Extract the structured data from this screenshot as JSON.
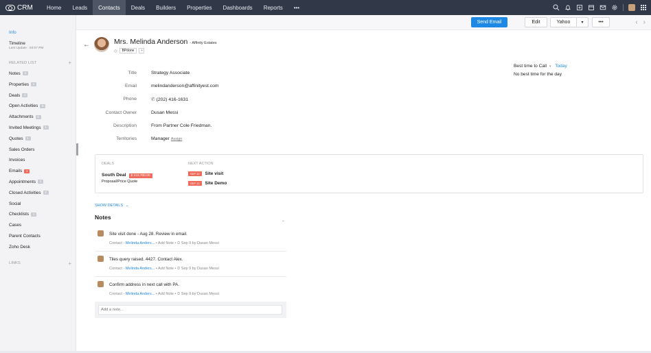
{
  "app": {
    "logo": "CRM"
  },
  "nav": [
    {
      "label": "Home"
    },
    {
      "label": "Leads"
    },
    {
      "label": "Contacts",
      "active": true
    },
    {
      "label": "Deals"
    },
    {
      "label": "Builders"
    },
    {
      "label": "Properties"
    },
    {
      "label": "Dashboards"
    },
    {
      "label": "Reports"
    },
    {
      "label": "•••"
    }
  ],
  "toolbar": {
    "send_email": "Send Email",
    "edit": "Edit",
    "yahoo": "Yahoo",
    "caret": "▾",
    "more": "•••",
    "prev": "‹",
    "next": "›"
  },
  "sidebar": {
    "info": "Info",
    "timeline": "Timeline",
    "last_update": "Last Update : 03:07 PM",
    "related_head": "RELATED LIST",
    "related": [
      {
        "label": "Notes",
        "badge": "3"
      },
      {
        "label": "Properties",
        "badge": "4"
      },
      {
        "label": "Deals",
        "badge": "2"
      },
      {
        "label": "Open Activities",
        "badge": "5"
      },
      {
        "label": "Attachments",
        "badge": "0"
      },
      {
        "label": "Invited Meetings",
        "badge": "1"
      },
      {
        "label": "Quotes",
        "badge": "1"
      },
      {
        "label": "Sales Orders",
        "badge": ""
      },
      {
        "label": "Invoices",
        "badge": ""
      },
      {
        "label": "Emails",
        "badge": "1",
        "red": true
      },
      {
        "label": "Appointments",
        "badge": "1"
      },
      {
        "label": "Closed Activities",
        "badge": "2"
      },
      {
        "label": "Social",
        "badge": ""
      },
      {
        "label": "Checklists",
        "badge": "1"
      },
      {
        "label": "Cases",
        "badge": ""
      },
      {
        "label": "Parent Contacts",
        "badge": ""
      },
      {
        "label": "Zoho Desk",
        "badge": ""
      }
    ],
    "links_head": "LINKS",
    "plus": "+"
  },
  "record": {
    "back": "←",
    "name": "Mrs. Melinda Anderson",
    "company": "- Affinity Estates",
    "tag": "BPdone",
    "tag_add": "+",
    "fields": [
      {
        "label": "Title",
        "value": "Strategy Associate"
      },
      {
        "label": "Email",
        "value": "melindanderson@affinityest.com"
      },
      {
        "label": "Phone",
        "value": "(202) 416-1631",
        "phone": true
      },
      {
        "label": "Contact Owner",
        "value": "Dusan Messi"
      },
      {
        "label": "Description",
        "value": "From Partner Cole Friedman."
      },
      {
        "label": "Territories",
        "value": "Manager",
        "link": "Assign"
      }
    ],
    "best_time_label": "Best time to Call",
    "best_time_caret": "▾",
    "best_time_value": "Today",
    "best_time_sub": "No best time for the day"
  },
  "deals_panel": {
    "deals_head": "DEALS",
    "next_head": "NEXT ACTION",
    "deal_name": "South Deal",
    "deal_amount": "$ 216,700.00",
    "deal_stage": "Proposal/Price Quote",
    "actions": [
      {
        "date": "SEP 10",
        "label": "Site visit"
      },
      {
        "date": "SEP 13",
        "label": "Site Demo"
      }
    ]
  },
  "show_details": "SHOW DETAILS",
  "notes": {
    "title": "Notes",
    "items": [
      {
        "text": "Site visit done - Aug 28. Review in email.",
        "context": "Contact - ",
        "link": "Melinda Anders...",
        "add": "Add Note",
        "when": "Sep 9  by  Dusan Messi"
      },
      {
        "text": "Tiles query raised. 4427. Contact Alex.",
        "context": "Contact - ",
        "link": "Melinda Anders...",
        "add": "Add Note",
        "when": "Sep 9  by  Dusan Messi"
      },
      {
        "text": "Confirm address in next call with PA.",
        "context": "Contact - ",
        "link": "Melinda Anders...",
        "add": "Add Note",
        "when": "Sep 9  by  Dusan Messi"
      }
    ],
    "placeholder": "Add a note..."
  },
  "colors": {
    "topbar": "#313949",
    "accent": "#1e88e5",
    "badge_red": "#f06b5b"
  }
}
